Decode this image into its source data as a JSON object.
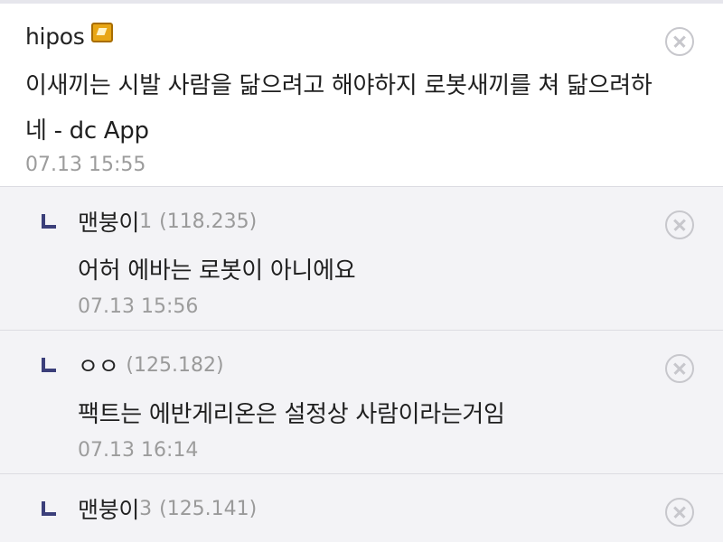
{
  "comments": [
    {
      "nick": "hipos",
      "nick_suffix": "",
      "ip": "",
      "text": "이새끼는 시발 사람을 닮으려고 해야하지 로봇새끼를 쳐 닮으려하네 - dc App",
      "time": "07.13 15:55",
      "icon": "gallery-manager-badge-icon"
    },
    {
      "nick": "맨붕이",
      "nick_suffix": "1",
      "ip": "(118.235)",
      "text": "어허 에바는 로봇이 아니에요",
      "time": "07.13 15:56"
    },
    {
      "nick": "ㅇㅇ",
      "nick_suffix": "",
      "ip": "(125.182)",
      "text": "팩트는 에반게리온은 설정상 사람이라는거임",
      "time": "07.13 16:14"
    },
    {
      "nick": "맨붕이",
      "nick_suffix": "3",
      "ip": "(125.141)",
      "text": "",
      "time": ""
    }
  ],
  "colors": {
    "reply_bg": "#f3f3f6",
    "reply_arrow": "#3b3f7a",
    "delete_icon": "#c7c7cc",
    "meta_text": "#9c9c9c"
  }
}
